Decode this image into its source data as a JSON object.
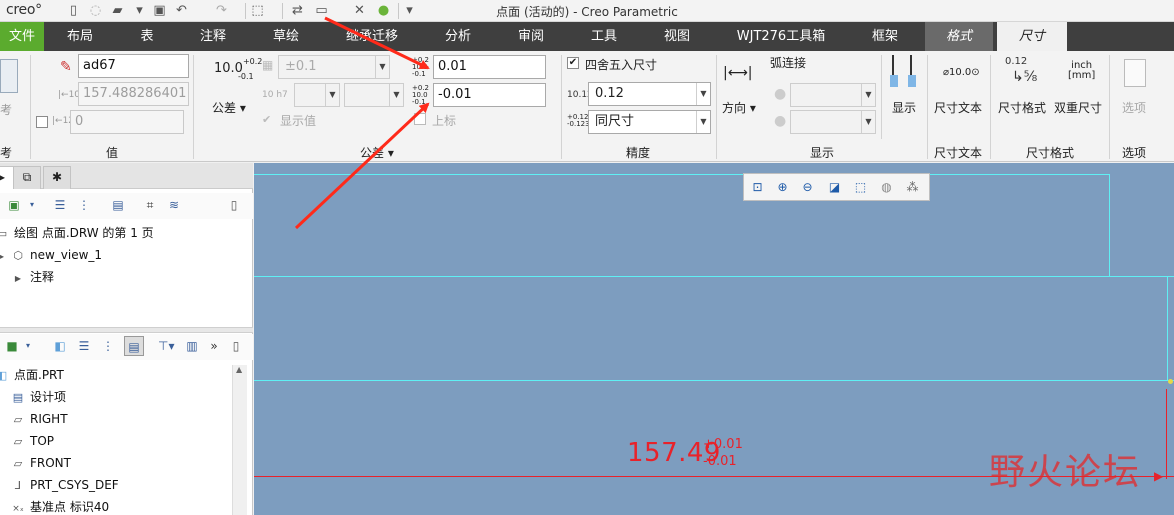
{
  "window": {
    "logo": "creo°",
    "title": "点面 (活动的) - Creo Parametric"
  },
  "tabs": [
    {
      "label": "文件"
    },
    {
      "label": "布局"
    },
    {
      "label": "表"
    },
    {
      "label": "注释"
    },
    {
      "label": "草绘"
    },
    {
      "label": "继承迁移"
    },
    {
      "label": "分析"
    },
    {
      "label": "审阅"
    },
    {
      "label": "工具"
    },
    {
      "label": "视图"
    },
    {
      "label": "WJT276工具箱"
    },
    {
      "label": "框架"
    },
    {
      "label": "格式"
    },
    {
      "label": "尺寸"
    }
  ],
  "ribbon": {
    "reference": {
      "label": "参考"
    },
    "value": {
      "name": "ad67",
      "nominal": "157.488286401",
      "override": "0",
      "group_label": "值"
    },
    "tolerance": {
      "sample_value": "10.0",
      "sample_upper": "+0.2",
      "sample_lower": "-0.1",
      "button_label": "公差",
      "combo_value": "±0.1",
      "fit_value": "10 h7",
      "show_value_label": "显示值",
      "upper_value": "0.01",
      "lower_value": "-0.01",
      "upper_label": "上标",
      "group_label": "公差"
    },
    "precision": {
      "round_label": "四舍五入尺寸",
      "precision_value": "0.12",
      "same_size_value": "同尺寸",
      "group_label": "精度"
    },
    "display": {
      "arc_label": "弧连接",
      "direction_label": "方向",
      "show_label": "显示",
      "group_label": "显示"
    },
    "dim_text": {
      "sample": "⌀10.0⊙",
      "label": "尺寸文本",
      "group_label": "尺寸文本"
    },
    "dim_format": {
      "format_sample": "0.12",
      "format_label": "尺寸格式",
      "dual_sample_top": "inch",
      "dual_sample_bottom": "[mm]",
      "dual_label": "双重尺寸",
      "group_label": "尺寸格式"
    },
    "options": {
      "label": "选项",
      "group_label": "选项"
    }
  },
  "tree_top": {
    "items": [
      {
        "label": "绘图 点面.DRW 的第 1 页"
      },
      {
        "label": "new_view_1"
      },
      {
        "label": "注释"
      }
    ]
  },
  "tree_bottom": {
    "items": [
      {
        "label": "点面.PRT"
      },
      {
        "label": "设计项"
      },
      {
        "label": "RIGHT"
      },
      {
        "label": "TOP"
      },
      {
        "label": "FRONT"
      },
      {
        "label": "PRT_CSYS_DEF"
      },
      {
        "label": "基准点 标识40"
      }
    ]
  },
  "canvas": {
    "dimension_value": "157.49",
    "tol_upper": "+0.01",
    "tol_lower": "-0.01",
    "watermark": "野火论坛"
  },
  "colors": {
    "canvas_bg": "#7d9dbf",
    "accent_red": "#e8222a",
    "file_tab": "#5bab2e",
    "tabbar": "#3f3f3f",
    "edge_cyan": "#5ff0f4"
  }
}
